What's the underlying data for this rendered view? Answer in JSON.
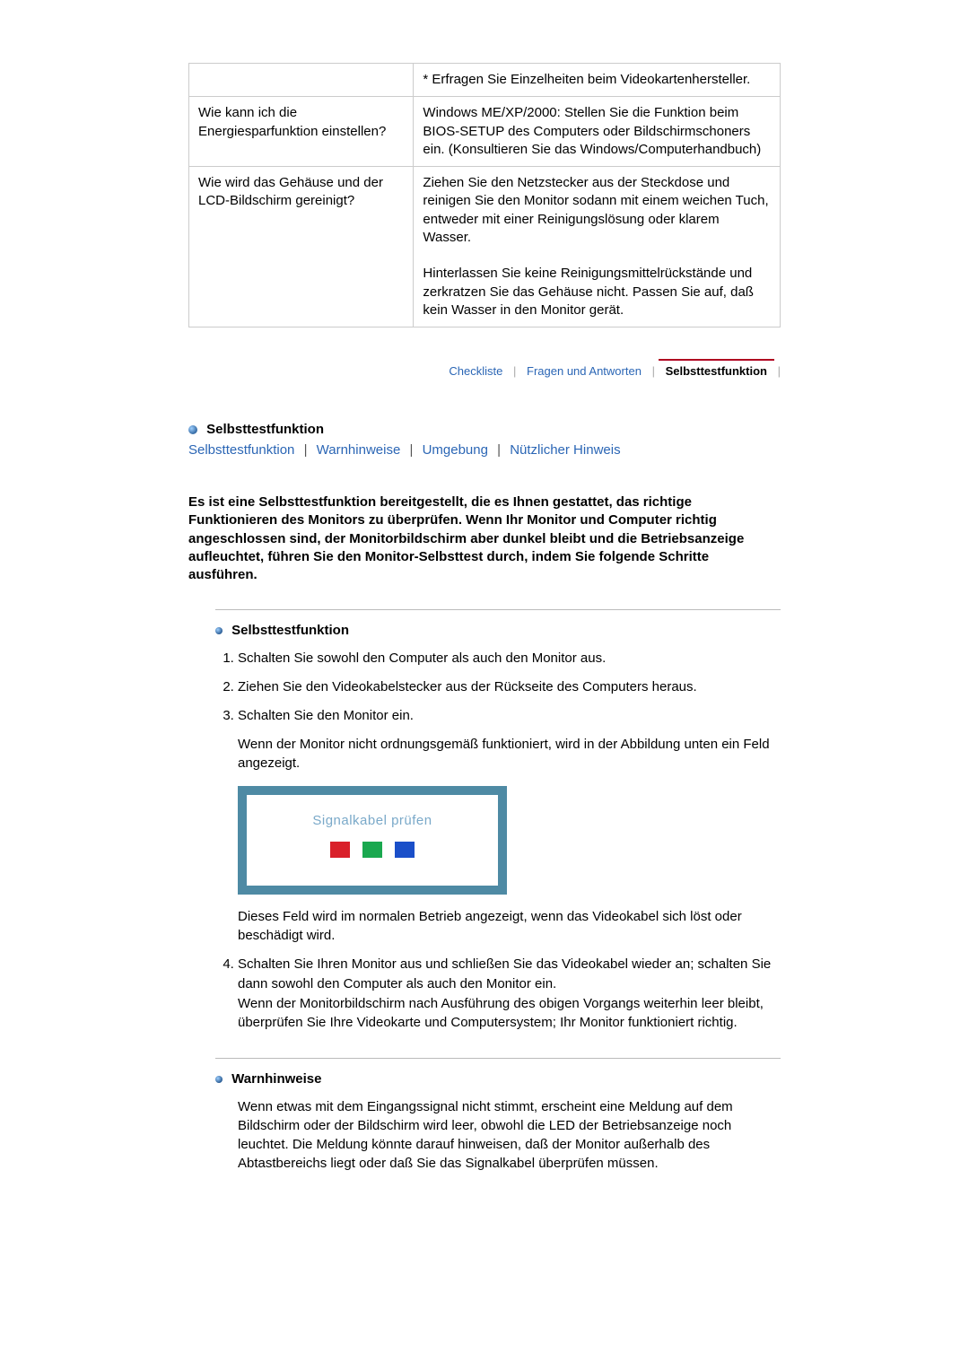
{
  "faq": {
    "rows": [
      {
        "q": "",
        "a": "* Erfragen Sie Einzelheiten beim Videokartenhersteller."
      },
      {
        "q": "Wie kann ich die Energiesparfunktion einstellen?",
        "a": "Windows ME/XP/2000: Stellen Sie die Funktion beim BIOS-SETUP des Computers oder Bildschirmschoners ein. (Konsultieren Sie das Windows/Computerhandbuch)"
      },
      {
        "q": "Wie wird das Gehäuse und der LCD-Bildschirm gereinigt?",
        "a": "Ziehen Sie den Netzstecker aus der Steckdose und reinigen Sie den Monitor sodann mit einem weichen Tuch, entweder mit einer Reinigungslösung oder klarem Wasser.\n\nHinterlassen Sie keine Reinigungsmittelrückstände und zerkratzen Sie das Gehäuse nicht. Passen Sie auf, daß kein Wasser in den Monitor gerät."
      }
    ]
  },
  "tabs": {
    "items": [
      "Checkliste",
      "Fragen und Antworten",
      "Selbsttestfunktion"
    ],
    "active_index": 2
  },
  "section": {
    "title": "Selbsttestfunktion",
    "links": [
      "Selbsttestfunktion",
      "Warnhinweise",
      "Umgebung",
      "Nützlicher Hinweis"
    ],
    "intro": "Es ist eine Selbsttestfunktion bereitgestellt, die es Ihnen gestattet, das richtige Funktionieren des Monitors zu überprüfen. Wenn Ihr Monitor und Computer richtig angeschlossen sind, der Monitorbildschirm aber dunkel bleibt und die Betriebsanzeige aufleuchtet, führen Sie den Monitor-Selbsttest durch, indem Sie folgende Schritte ausführen."
  },
  "selftest": {
    "header": "Selbsttestfunktion",
    "steps": {
      "s1": "Schalten Sie sowohl den Computer als auch den Monitor aus.",
      "s2": "Ziehen Sie den Videokabelstecker aus der Rückseite des Computers heraus.",
      "s3a": "Schalten Sie den Monitor ein.",
      "s3b": "Wenn der Monitor nicht ordnungsgemäß funktioniert, wird in der Abbildung unten ein Feld angezeigt.",
      "s3_monitor_text": "Signalkabel prüfen",
      "s3c": "Dieses Feld wird im normalen Betrieb angezeigt, wenn das Videokabel sich löst oder beschädigt wird.",
      "s4a": "Schalten Sie Ihren Monitor aus und schließen Sie das Videokabel wieder an; schalten Sie dann sowohl den Computer als auch den Monitor ein.",
      "s4b": "Wenn der Monitorbildschirm nach Ausführung des obigen Vorgangs weiterhin leer bleibt, überprüfen Sie Ihre Videokarte und Computersystem; Ihr Monitor funktioniert richtig."
    }
  },
  "warnings": {
    "header": "Warnhinweise",
    "body": "Wenn etwas mit dem Eingangssignal nicht stimmt, erscheint eine Meldung auf dem Bildschirm oder der Bildschirm wird leer, obwohl die LED der Betriebsanzeige noch leuchtet. Die Meldung könnte darauf hinweisen, daß der Monitor außerhalb des Abtastbereichs liegt oder daß Sie das Signalkabel überprüfen müssen."
  }
}
